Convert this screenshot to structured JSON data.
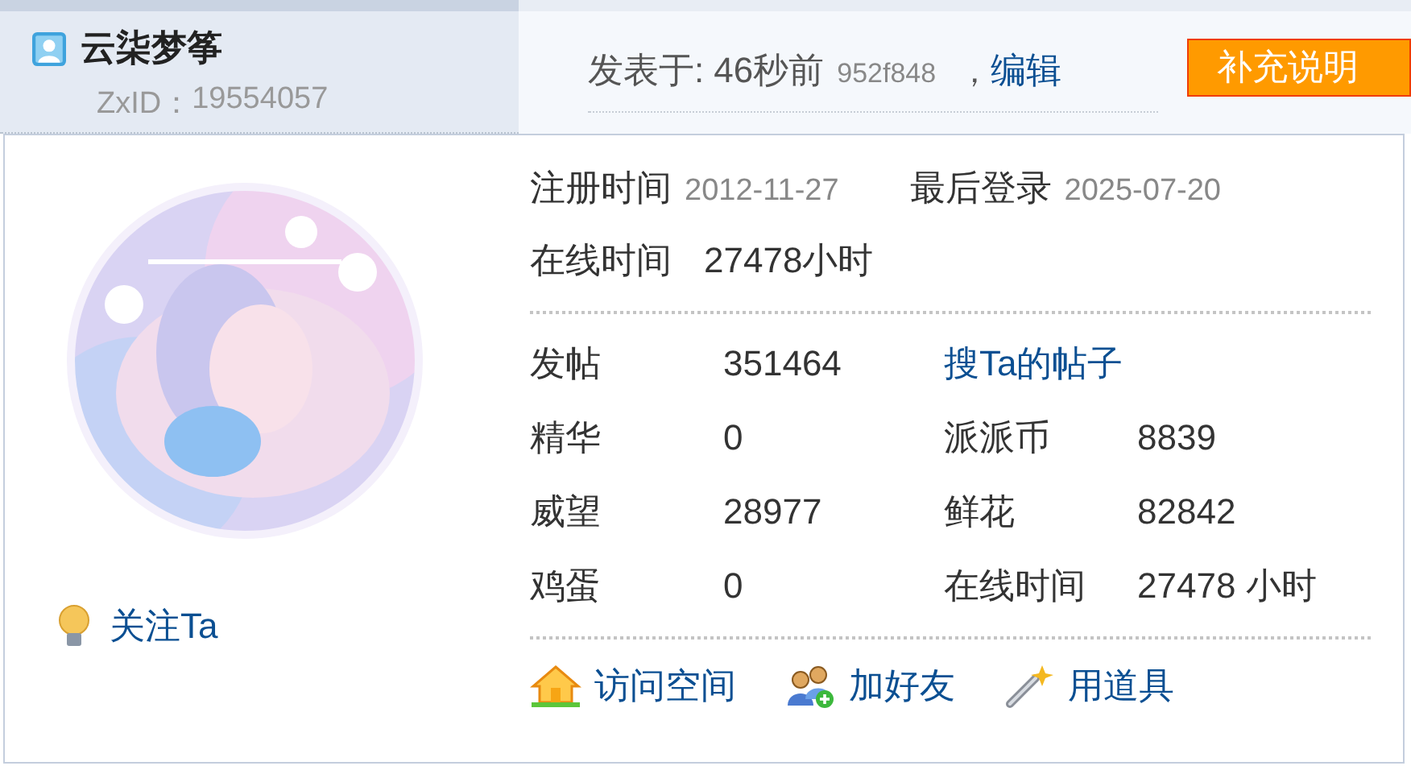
{
  "user": {
    "name": "云柒梦筝",
    "zxid_label": "ZxID：",
    "zxid": "19554057"
  },
  "post_meta": {
    "posted_label": "发表于:",
    "posted_time": "46秒前",
    "hash": "952f848",
    "separator": "，",
    "edit_link": "编辑",
    "supplement_button": "补充说明"
  },
  "profile": {
    "avatar": {
      "kind": "picture"
    },
    "follow_link": "关注Ta",
    "info": [
      {
        "label": "注册时间",
        "value": "2012-11-27"
      },
      {
        "label": "最后登录",
        "value": "2025-07-20"
      }
    ],
    "online": {
      "label": "在线时间",
      "value": "27478小时"
    },
    "stats": [
      [
        {
          "kind": "label",
          "text": "发帖"
        },
        {
          "kind": "value",
          "text": "351464"
        },
        {
          "kind": "link",
          "text": "搜Ta的帖子"
        }
      ],
      [
        {
          "kind": "label",
          "text": "精华"
        },
        {
          "kind": "value",
          "text": "0"
        },
        {
          "kind": "label",
          "text": "派派币"
        },
        {
          "kind": "value",
          "text": "8839"
        }
      ],
      [
        {
          "kind": "label",
          "text": "威望"
        },
        {
          "kind": "value",
          "text": "28977"
        },
        {
          "kind": "label",
          "text": "鲜花"
        },
        {
          "kind": "value",
          "text": "82842"
        }
      ],
      [
        {
          "kind": "label",
          "text": "鸡蛋"
        },
        {
          "kind": "value",
          "text": "0"
        },
        {
          "kind": "label",
          "text": "在线时间"
        },
        {
          "kind": "value",
          "text": "27478 小时"
        }
      ]
    ],
    "actions": [
      "访问空间",
      "加好友",
      "用道具"
    ]
  }
}
